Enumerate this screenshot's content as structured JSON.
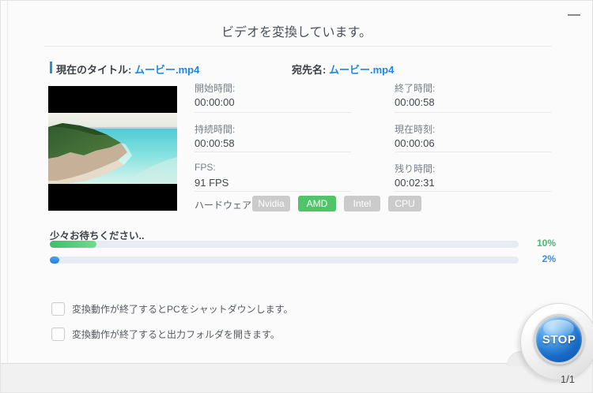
{
  "window": {
    "minimize_icon": "minimize"
  },
  "header": {
    "title": "ビデオを変換しています。"
  },
  "file_info": {
    "current_title_label": "現在のタイトル:",
    "current_title_value": "ムービー.mp4",
    "destination_label": "宛先名:",
    "destination_value": "ムービー.mp4"
  },
  "fields": [
    {
      "label": "開始時間:",
      "value": "00:00:00"
    },
    {
      "label": "終了時間:",
      "value": "00:00:58"
    },
    {
      "label": "持続時間:",
      "value": "00:00:58"
    },
    {
      "label": "現在時刻:",
      "value": "00:00:06"
    },
    {
      "label": "FPS:",
      "value": "91 FPS"
    },
    {
      "label": "残り時間:",
      "value": "00:02:31"
    }
  ],
  "hardware": {
    "label": "ハードウェア:",
    "options": [
      {
        "name": "Nvidia",
        "active": false
      },
      {
        "name": "AMD",
        "active": true
      },
      {
        "name": "Intel",
        "active": false
      },
      {
        "name": "CPU",
        "active": false
      }
    ],
    "active_color": "#4fc469",
    "inactive_color": "#cbcbcb"
  },
  "progress": {
    "message": "少々お待ちください..",
    "bars": [
      {
        "percent": 10,
        "label": "10%",
        "color": "green",
        "hex": "#45b96e"
      },
      {
        "percent": 2,
        "label": "2%",
        "color": "blue",
        "hex": "#2e8fe8"
      }
    ]
  },
  "checkboxes": [
    {
      "label": "変換動作が終了するとPCをシャットダウンします。",
      "checked": false
    },
    {
      "label": "変換動作が終了すると出力フォルダを開きます。",
      "checked": false
    }
  ],
  "footer": {
    "page_indicator": "1/1",
    "stop_button_label": "STOP"
  },
  "colors": {
    "accent_blue": "#2b8ce6",
    "link_blue": "#1b87e9"
  }
}
